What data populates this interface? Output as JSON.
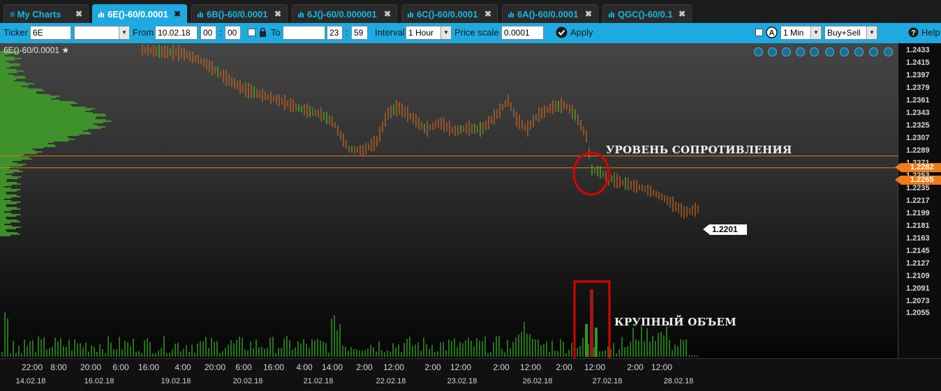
{
  "tabs": [
    {
      "label": "My Charts",
      "icon": "list-icon",
      "active": false
    },
    {
      "label": "6E()-60/0.0001",
      "icon": "bar-chart-icon",
      "active": true
    },
    {
      "label": "6B()-60/0.0001",
      "icon": "bar-chart-icon",
      "active": false
    },
    {
      "label": "6J()-60/0.000001",
      "icon": "bar-chart-icon",
      "active": false
    },
    {
      "label": "6C()-60/0.0001",
      "icon": "bar-chart-icon",
      "active": false
    },
    {
      "label": "6A()-60/0.0001",
      "icon": "bar-chart-icon",
      "active": false
    },
    {
      "label": "QGC()-60/0.1",
      "icon": "bar-chart-icon",
      "active": false
    }
  ],
  "close_glyph": "✖",
  "toolbar": {
    "ticker_label": "Ticker",
    "ticker_value": "6E",
    "from_label": "From",
    "from_date": "10.02.18",
    "from_hour": "00",
    "from_min": "00",
    "to_label": "To",
    "to_date": "",
    "to_hour": "23",
    "to_min": "59",
    "interval_label": "Interval",
    "interval_value": "1 Hour",
    "price_scale_label": "Price scale",
    "price_scale_value": "0.0001",
    "apply_label": "Apply",
    "min_value": "1 Min",
    "side_value": "Buy+Sell",
    "help_label": "Help"
  },
  "chart": {
    "title": "6E()-60/0.0001",
    "annotation_resistance": "УРОВЕНЬ СОПРОТИВЛЕНИЯ",
    "annotation_volume": "КРУПНЫЙ ОБЪЕМ",
    "tag_upper": "1.2282",
    "tag_lower": "1.2265",
    "last_price": "1.2201",
    "colors": {
      "bar": "#d2691e",
      "green": "#39d11f",
      "level": "#f07c16",
      "circle": "#e00000",
      "volume": "#2f9a1d"
    }
  },
  "chart_data": {
    "type": "bar",
    "instrument": "6E()",
    "interval": "1 Hour",
    "y_ticks": [
      "1.2433",
      "1.2415",
      "1.2397",
      "1.2379",
      "1.2361",
      "1.2343",
      "1.2325",
      "1.2307",
      "1.2289",
      "1.2271",
      "1.2253",
      "1.2235",
      "1.2217",
      "1.2199",
      "1.2181",
      "1.2163",
      "1.2145",
      "1.2127",
      "1.2109",
      "1.2091",
      "1.2073",
      "1.2055"
    ],
    "x_ticks": [
      "22:00",
      "8:00",
      "20:00",
      "6:00",
      "16:00",
      "4:00",
      "20:00",
      "6:00",
      "16:00",
      "4:00",
      "14:00",
      "2:00",
      "12:00",
      "2:00",
      "12:00",
      "2:00",
      "12:00",
      "2:00",
      "12:00",
      "2:00",
      "12:00"
    ],
    "x_dates": [
      "14.02.18",
      "16.02.18",
      "19.02.18",
      "20.02.18",
      "21.02.18",
      "22.02.18",
      "23.02.18",
      "26.02.18",
      "27.02.18",
      "28.02.18"
    ],
    "resistance_levels": [
      1.2282,
      1.2265
    ],
    "last_price": 1.2201,
    "price_path": [
      [
        202,
        1.2435
      ],
      [
        230,
        1.2432
      ],
      [
        260,
        1.243
      ],
      [
        290,
        1.2418
      ],
      [
        310,
        1.2404
      ],
      [
        330,
        1.239
      ],
      [
        350,
        1.2378
      ],
      [
        375,
        1.237
      ],
      [
        400,
        1.2362
      ],
      [
        430,
        1.235
      ],
      [
        460,
        1.2342
      ],
      [
        478,
        1.233
      ],
      [
        490,
        1.2308
      ],
      [
        500,
        1.2292
      ],
      [
        520,
        1.229
      ],
      [
        540,
        1.2303
      ],
      [
        555,
        1.2342
      ],
      [
        570,
        1.2352
      ],
      [
        590,
        1.2338
      ],
      [
        610,
        1.232
      ],
      [
        630,
        1.233
      ],
      [
        650,
        1.2318
      ],
      [
        670,
        1.2322
      ],
      [
        690,
        1.232
      ],
      [
        710,
        1.234
      ],
      [
        728,
        1.2362
      ],
      [
        740,
        1.2335
      ],
      [
        755,
        1.232
      ],
      [
        770,
        1.234
      ],
      [
        790,
        1.2352
      ],
      [
        810,
        1.2355
      ],
      [
        825,
        1.234
      ],
      [
        840,
        1.231
      ],
      [
        848,
        1.2262
      ],
      [
        858,
        1.226
      ],
      [
        870,
        1.2252
      ],
      [
        885,
        1.2246
      ],
      [
        905,
        1.224
      ],
      [
        920,
        1.2236
      ],
      [
        935,
        1.223
      ],
      [
        950,
        1.2222
      ],
      [
        965,
        1.2212
      ],
      [
        980,
        1.2201
      ],
      [
        1000,
        1.2206
      ]
    ]
  }
}
